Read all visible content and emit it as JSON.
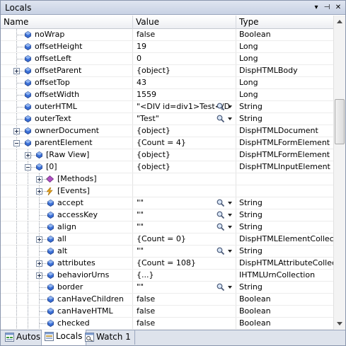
{
  "window": {
    "title": "Locals"
  },
  "titlebar_buttons": {
    "dropdown": "▾",
    "pin": "⊣",
    "close": "✕"
  },
  "columns": {
    "name": "Name",
    "value": "Value",
    "type": "Type"
  },
  "rows": [
    {
      "name": "noWrap",
      "value": "false",
      "type": "Boolean"
    },
    {
      "name": "offsetHeight",
      "value": "19",
      "type": "Long"
    },
    {
      "name": "offsetLeft",
      "value": "0",
      "type": "Long"
    },
    {
      "name": "offsetParent",
      "value": "{object}",
      "type": "DispHTMLBody"
    },
    {
      "name": "offsetTop",
      "value": "43",
      "type": "Long"
    },
    {
      "name": "offsetWidth",
      "value": "1559",
      "type": "Long"
    },
    {
      "name": "outerHTML",
      "value": "\"<DIV id=div1>Test</D",
      "type": "String"
    },
    {
      "name": "outerText",
      "value": "\"Test\"",
      "type": "String"
    },
    {
      "name": "ownerDocument",
      "value": "{object}",
      "type": "DispHTMLDocument"
    },
    {
      "name": "parentElement",
      "value": "{Count = 4}",
      "type": "DispHTMLFormElement"
    },
    {
      "name": "[Raw View]",
      "value": "{object}",
      "type": "DispHTMLFormElement"
    },
    {
      "name": "[0]",
      "value": "{object}",
      "type": "DispHTMLInputElement"
    },
    {
      "name": "[Methods]",
      "value": "",
      "type": ""
    },
    {
      "name": "[Events]",
      "value": "",
      "type": ""
    },
    {
      "name": "accept",
      "value": "\"\"",
      "type": "String"
    },
    {
      "name": "accessKey",
      "value": "\"\"",
      "type": "String"
    },
    {
      "name": "align",
      "value": "\"\"",
      "type": "String"
    },
    {
      "name": "all",
      "value": "{Count = 0}",
      "type": "DispHTMLElementCollection"
    },
    {
      "name": "alt",
      "value": "\"\"",
      "type": "String"
    },
    {
      "name": "attributes",
      "value": "{Count = 108}",
      "type": "DispHTMLAttributeCollection"
    },
    {
      "name": "behaviorUrns",
      "value": "{...}",
      "type": "IHTMLUrnCollection"
    },
    {
      "name": "border",
      "value": "\"\"",
      "type": "String"
    },
    {
      "name": "canHaveChildren",
      "value": "false",
      "type": "Boolean"
    },
    {
      "name": "canHaveHTML",
      "value": "false",
      "type": "Boolean"
    },
    {
      "name": "checked",
      "value": "false",
      "type": "Boolean"
    }
  ],
  "tabs": [
    {
      "label": "Autos"
    },
    {
      "label": "Locals"
    },
    {
      "label": "Watch 1"
    }
  ],
  "colors": {
    "property_icon": "#3b6fd6",
    "method_icon": "#b04fc4",
    "event_icon": "#e8a21a"
  }
}
